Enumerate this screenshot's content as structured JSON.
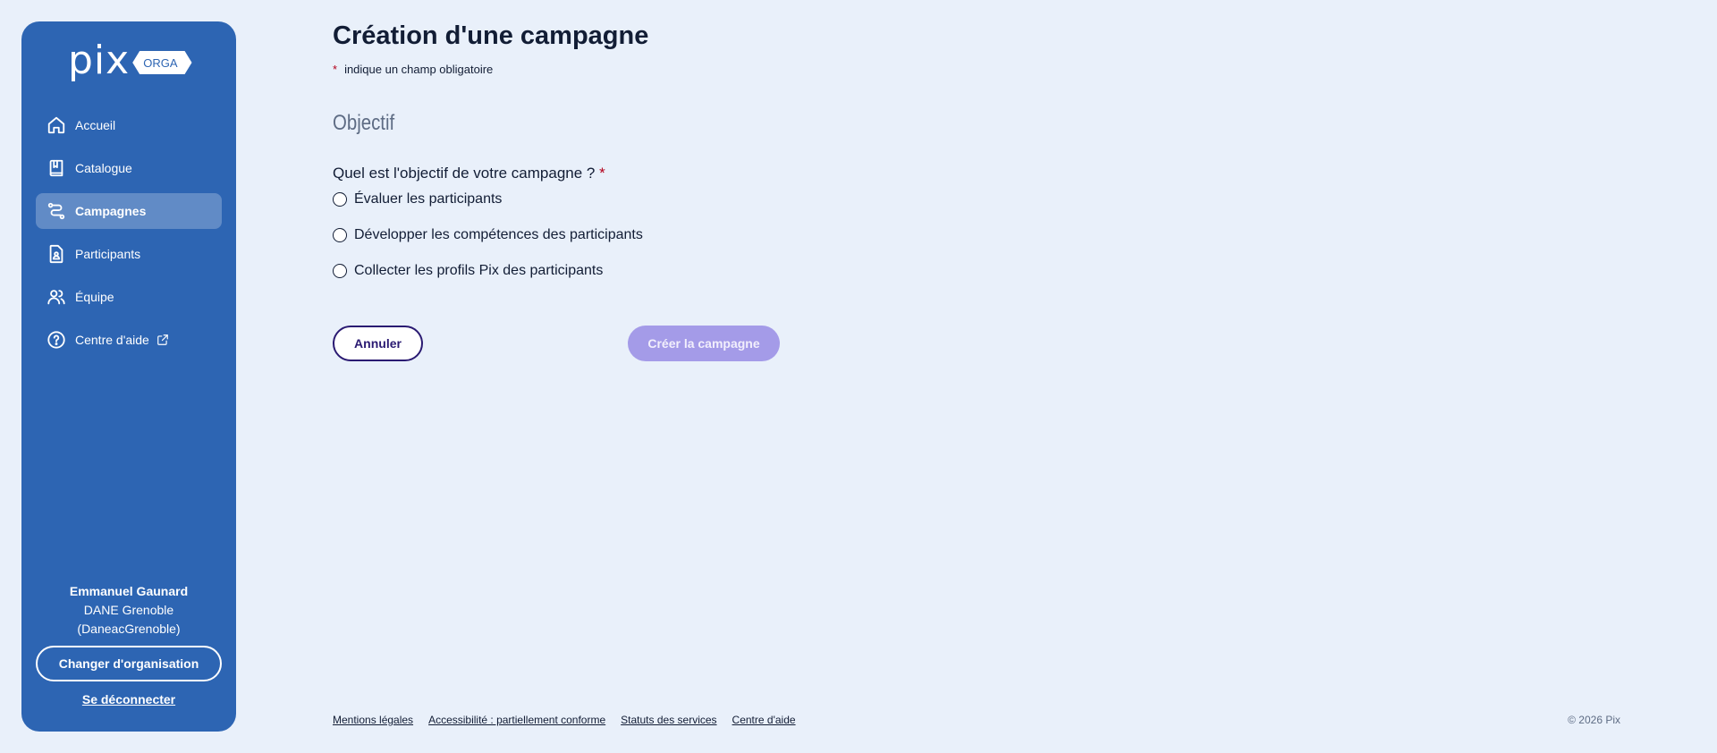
{
  "brand": {
    "logo_text": "pix",
    "badge": "ORGA"
  },
  "sidebar": {
    "items": [
      {
        "label": "Accueil",
        "icon": "home-icon"
      },
      {
        "label": "Catalogue",
        "icon": "book-icon"
      },
      {
        "label": "Campagnes",
        "icon": "route-icon",
        "active": true
      },
      {
        "label": "Participants",
        "icon": "participant-file-icon"
      },
      {
        "label": "Équipe",
        "icon": "team-icon"
      },
      {
        "label": "Centre d'aide",
        "icon": "help-icon",
        "external_icon": "external-link-icon"
      }
    ],
    "user": {
      "name": "Emmanuel Gaunard",
      "org": "DANE Grenoble",
      "org_code": "(DaneacGrenoble)"
    },
    "change_org_label": "Changer d'organisation",
    "logout_label": "Se déconnecter"
  },
  "main": {
    "title": "Création d'une campagne",
    "required_mark": "*",
    "required_note": "indique un champ obligatoire",
    "section_title": "Objectif",
    "question": "Quel est l'objectif de votre campagne ?",
    "question_required": "*",
    "options": [
      "Évaluer les participants",
      "Développer les compétences des participants",
      "Collecter les profils Pix des participants"
    ],
    "cancel_label": "Annuler",
    "create_label": "Créer la campagne"
  },
  "footer": {
    "links": [
      "Mentions légales",
      "Accessibilité : partiellement conforme",
      "Statuts des services",
      "Centre d'aide"
    ],
    "copyright": "© 2026 Pix"
  },
  "colors": {
    "sidebar_bg": "#2d65b3",
    "page_bg": "#e9f0fa",
    "primary_dark": "#2a1a72",
    "disabled_button": "#a49be8",
    "required": "#b3001b"
  }
}
